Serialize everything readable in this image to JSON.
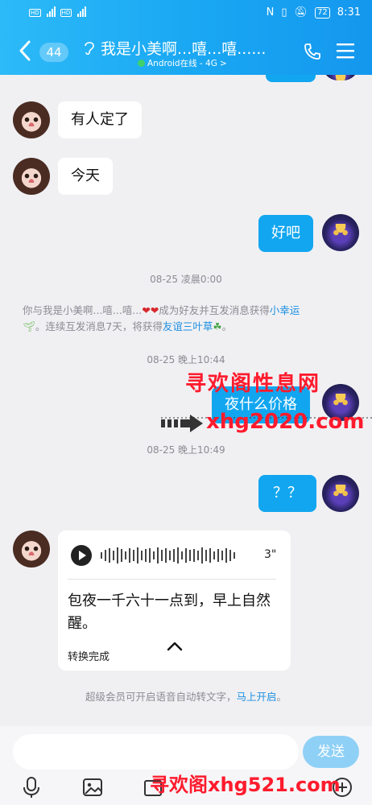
{
  "status": {
    "time": "8:31",
    "battery": "72",
    "network": "4G"
  },
  "header": {
    "badge_count": "44",
    "title": "我是小美啊...嘻...嘻......",
    "subtitle": "Android在线 - 4G",
    "subtitle_chevron": ">"
  },
  "messages": {
    "m1": "有人定了",
    "m2": "今天",
    "m3": "好吧",
    "ts1": "08-25 凌晨0:00",
    "sys_prefix": "你与我是小美啊...嘻...嘻...",
    "sys_mid1": "成为好友并互发消息获得",
    "sys_link1": "小幸运",
    "sys_mid2": "。连续互发消息7天，将获得",
    "sys_link2": "友谊三叶草",
    "sys_end": "。",
    "ts2": "08-25 晚上10:44",
    "m4": "夜什么价格",
    "ts3": "08-25 晚上10:49",
    "m5": "？？",
    "voice_duration": "3\"",
    "voice_text": "包夜一千六十一点到，早上自然醒。",
    "voice_status": "转换完成",
    "vip_text": "超级会员可开启语音自动转文字，",
    "vip_link": "马上开启",
    "vip_end": "。"
  },
  "watermarks": {
    "w1": "寻欢阁性息网",
    "w2": "xhg2020.com",
    "w3": "寻欢阁xhg521.com"
  },
  "input": {
    "send_label": "发送",
    "value": ""
  },
  "icons": [
    "back-arrow-icon",
    "ear-icon",
    "phone-icon",
    "menu-icon",
    "play-icon",
    "chevron-up-icon",
    "mic-icon",
    "image-icon",
    "plus-icon"
  ],
  "colors": {
    "header_blue": "#1aa8f3",
    "bubble_blue": "#12a6f0",
    "link_blue": "#1d8fe0",
    "send_disabled": "#8fd0f6"
  }
}
